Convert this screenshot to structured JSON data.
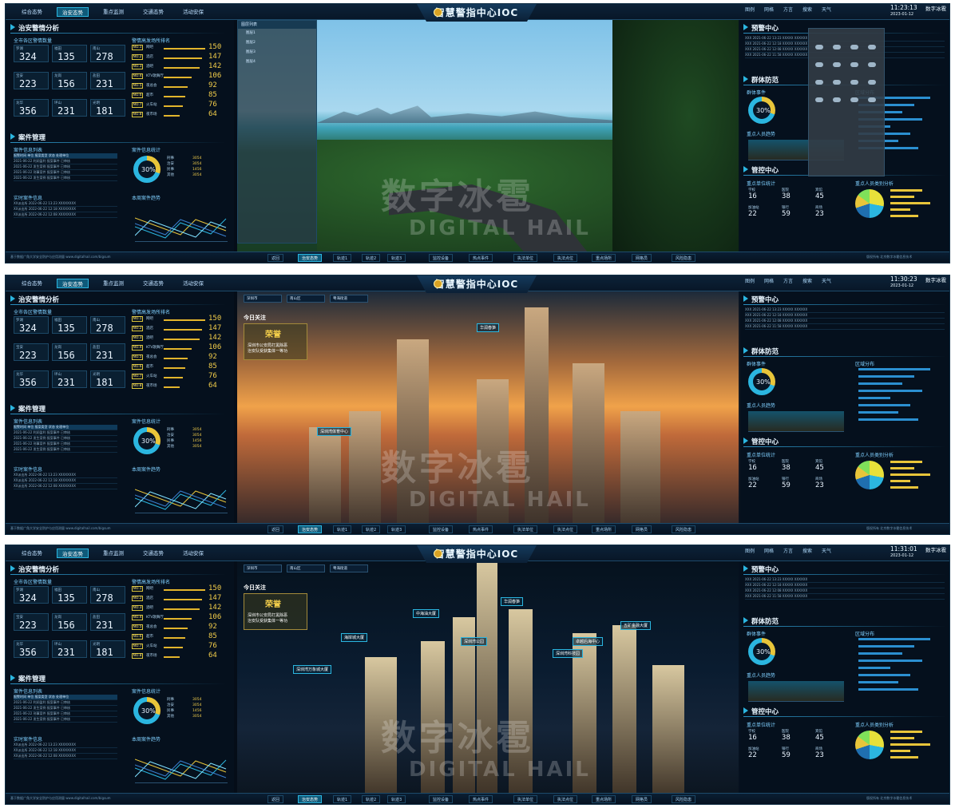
{
  "title": "智慧警指中心IOC",
  "nav": [
    "综合态势",
    "治安态势",
    "重点监测",
    "交通态势",
    "活动安保"
  ],
  "topright": [
    "图例",
    "网格",
    "方言",
    "搜索",
    "天气"
  ],
  "logo": "数字冰雹",
  "watermark": {
    "cn": "数字冰雹",
    "en": "DIGITAL HAIL"
  },
  "left": {
    "sec1": "治安警情分析",
    "sub1": "全市各区警情数量",
    "sub2": "警情高发场所排名",
    "stats": [
      {
        "label": "罗湖",
        "value": "324"
      },
      {
        "label": "福田",
        "value": "135"
      },
      {
        "label": "南山",
        "value": "278"
      },
      {
        "label": "宝安",
        "value": "223"
      },
      {
        "label": "龙岗",
        "value": "156"
      },
      {
        "label": "盐田",
        "value": "231"
      },
      {
        "label": "龙华",
        "value": "356"
      },
      {
        "label": "坪山",
        "value": "231"
      },
      {
        "label": "光明",
        "value": "181"
      }
    ],
    "ranks": [
      {
        "no": "NO.1",
        "name": "网吧",
        "value": "150",
        "pct": 100
      },
      {
        "no": "NO.2",
        "name": "酒店",
        "value": "147",
        "pct": 92
      },
      {
        "no": "NO.3",
        "name": "酒吧",
        "value": "142",
        "pct": 86
      },
      {
        "no": "NO.4",
        "name": "KTV歌舞厅",
        "value": "106",
        "pct": 68
      },
      {
        "no": "NO.5",
        "name": "夜总会",
        "value": "92",
        "pct": 58
      },
      {
        "no": "NO.6",
        "name": "超市",
        "value": "85",
        "pct": 52
      },
      {
        "no": "NO.7",
        "name": "火车站",
        "value": "76",
        "pct": 46
      },
      {
        "no": "NO.8",
        "name": "夜市场",
        "value": "64",
        "pct": 38
      }
    ],
    "sec2": "案件管理",
    "sub3": "案件信息列表",
    "sub4": "案件信息统计",
    "table_header": "报警时间 单位 报案类型 状态 处理单位",
    "table_rows": [
      "2021-06-22 利润盈利 报案事件 已审核",
      "2021-06-22 发生案例 报案事件 已审核",
      "2021-06-22 刑事案件 报案事件 已审核",
      "2021-06-22 发生案例 报案事件 已审核"
    ],
    "donut_pct": "30%",
    "donut_legend": [
      {
        "k": "刑事",
        "v": "3054"
      },
      {
        "k": "治安",
        "v": "3054"
      },
      {
        "k": "民事",
        "v": "1456"
      },
      {
        "k": "其他",
        "v": "3054"
      }
    ],
    "sub5": "实时案件信息",
    "sub6": "本周案件趋势",
    "rt_rows": [
      "XX派出所 2022-06-22 13:23 XXXXXXXX",
      "XX派出所 2022-06-22 12:18 XXXXXXXX",
      "XX派出所 2022-06-22 12:08 XXXXXXXX"
    ]
  },
  "right": {
    "sec1": "预警中心",
    "sec2": "群体防范",
    "sub1": "群体事件",
    "sub2": "区域分布",
    "sub3": "重点人员趋势",
    "sec3": "管控中心",
    "sub4": "重点单位统计",
    "sub5": "重点人员类别分析",
    "donut_pct": "30%",
    "warn_rows": [
      "XXX 2021-06-22 13:23 XXXXX XXXXXX",
      "XXX 2021-06-22 12:18 XXXXX XXXXXX",
      "XXX 2021-06-22 12:08 XXXXX XXXXXX",
      "XXX 2021-06-22 11:58 XXXXX XXXXXX"
    ],
    "units": [
      {
        "k": "学校",
        "v": "16"
      },
      {
        "k": "医院",
        "v": "38"
      },
      {
        "k": "宾馆",
        "v": "45"
      },
      {
        "k": "加油站",
        "v": "22"
      },
      {
        "k": "银行",
        "v": "59"
      },
      {
        "k": "商场",
        "v": "23"
      }
    ]
  },
  "screens": [
    {
      "time": "11:23:13",
      "date": "2023-01-12"
    },
    {
      "time": "11:30:23",
      "date": "2023-01-12"
    },
    {
      "time": "11:31:01",
      "date": "2023-01-12"
    }
  ],
  "bottom": [
    "返回",
    "治安态势",
    "轨迹1",
    "轨迹2",
    "轨迹3",
    "监控设备",
    "热点事件",
    "执法单位",
    "执法点位",
    "重点场所",
    "网格员",
    "风险隐患"
  ],
  "layers": {
    "title": "图层列表",
    "items": [
      "图层1",
      "图层2",
      "图层3",
      "图层4"
    ]
  },
  "today": {
    "title": "今日关注",
    "honor": "荣誉",
    "text": "深圳市公安局打黑除恶",
    "text2": "治安队受获集体一等功",
    "selects": [
      "深圳市",
      "南山区",
      "粤海街道"
    ]
  },
  "pins2": [
    "深圳湾体育中心",
    "华润春笋"
  ],
  "pins3": [
    "中海油大厦",
    "海岸城大厦",
    "深圳湾公园",
    "华润春笋",
    "卓越后海中心",
    "五矿金融大厦",
    "深圳湾科技园",
    "深圳湾万象城大厦"
  ],
  "footer_left": "基于数据广角大学安全防护与应用测量 www.digitalhail.com/bigsum",
  "footer_right": "版权所有 北京数字冰雹信息技术"
}
